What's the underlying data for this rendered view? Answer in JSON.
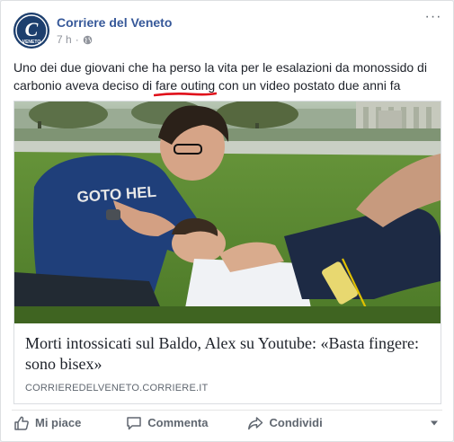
{
  "post": {
    "page_name": "Corriere del Veneto",
    "time": "7 h",
    "separator": "·",
    "text_before": "Uno dei due giovani che ha perso la vita per le esalazioni da monossido di carbonio aveva deciso di ",
    "text_highlight": "fare outing",
    "text_after": " con un video postato due anni fa",
    "underline_color": "#e0101a",
    "more_label": "···",
    "avatar_letter": "C",
    "avatar_caption": "VENETO"
  },
  "link": {
    "title": "Morti intossicati sul Baldo, Alex su Youtube: «Basta fingere: sono bisex»",
    "domain": "CORRIEREDELVENETO.CORRIERE.IT",
    "image_icon": "photo-two-men-on-grass",
    "shirt_text": "GOTO HEL"
  },
  "actions": {
    "like": "Mi piace",
    "comment": "Commenta",
    "share": "Condividi"
  },
  "icons": {
    "like": "thumbs-up-icon",
    "comment": "speech-bubble-icon",
    "share": "share-arrow-icon",
    "privacy": "globe-icon",
    "menu": "caret-down-icon"
  },
  "colors": {
    "link": "#365899",
    "meta": "#90949c",
    "action": "#606770"
  }
}
